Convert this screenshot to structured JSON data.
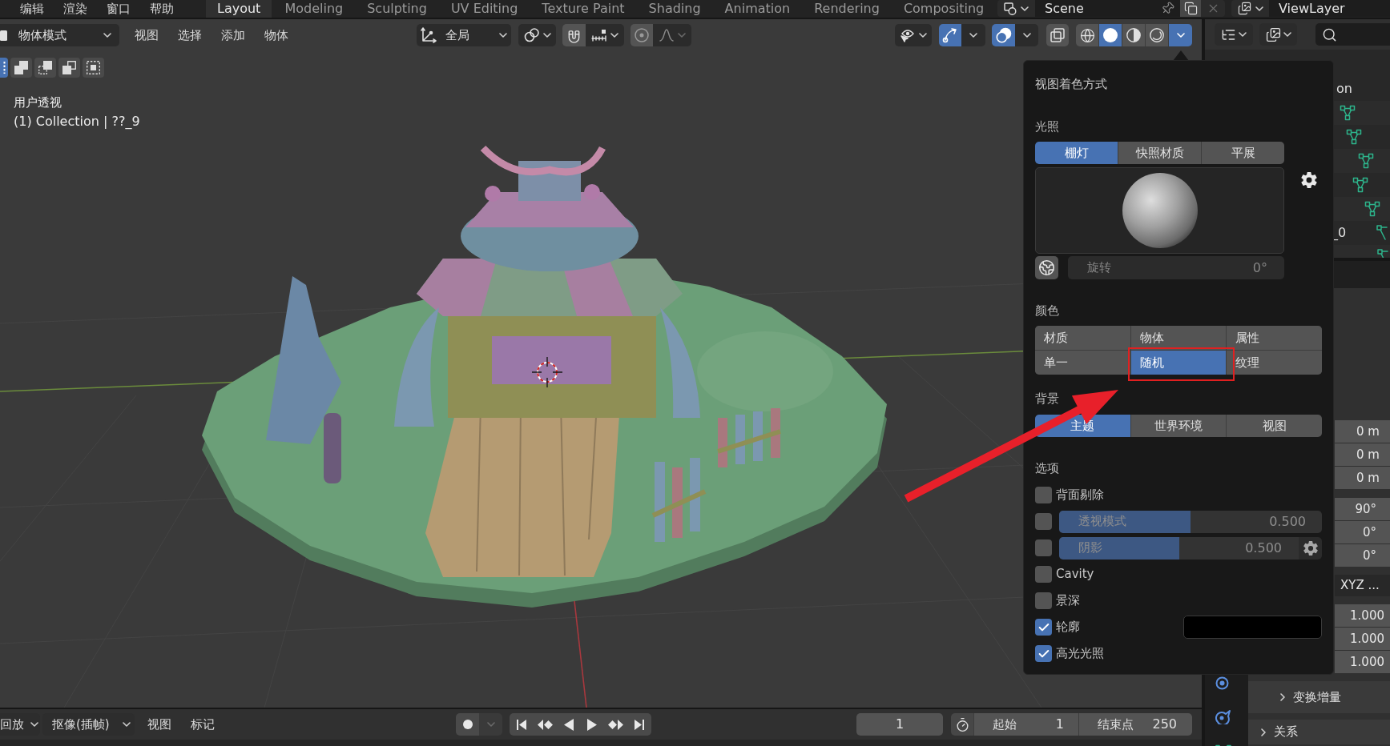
{
  "top_bar": {
    "menus": [
      "编辑",
      "渲染",
      "窗口",
      "帮助"
    ],
    "workspaces": [
      {
        "label": "Layout",
        "selected": true
      },
      {
        "label": "Modeling",
        "selected": false
      },
      {
        "label": "Sculpting",
        "selected": false
      },
      {
        "label": "UV Editing",
        "selected": false
      },
      {
        "label": "Texture Paint",
        "selected": false
      },
      {
        "label": "Shading",
        "selected": false
      },
      {
        "label": "Animation",
        "selected": false
      },
      {
        "label": "Rendering",
        "selected": false
      },
      {
        "label": "Compositing",
        "selected": false
      }
    ],
    "scene": "Scene",
    "view_layer": "ViewLayer"
  },
  "viewport_header": {
    "mode": "物体模式",
    "menus": [
      "视图",
      "选择",
      "添加",
      "物体"
    ],
    "orientation": "全局",
    "gizmos_on": true,
    "overlays_on": true,
    "xray_on": false,
    "shading_modes": [
      {
        "kind": "wireframe",
        "selected": false
      },
      {
        "kind": "solid",
        "selected": true
      },
      {
        "kind": "material",
        "selected": false
      },
      {
        "kind": "rendered",
        "selected": false
      }
    ],
    "shading_menu_open": true
  },
  "tool_header": {
    "select_modes": [
      {
        "kind": "set",
        "selected": true
      },
      {
        "kind": "extend",
        "selected": false
      },
      {
        "kind": "subtract",
        "selected": false
      },
      {
        "kind": "invert",
        "selected": false
      },
      {
        "kind": "intersect",
        "selected": false
      }
    ]
  },
  "viewport": {
    "view_name": "用户透视",
    "collection_info": "(1) Collection | ??_9"
  },
  "shading_popover": {
    "title": "视图着色方式",
    "lighting": {
      "label": "光照",
      "options": [
        {
          "label": "棚灯",
          "selected": true
        },
        {
          "label": "快照材质",
          "selected": false
        },
        {
          "label": "平展",
          "selected": false
        }
      ],
      "rotation": {
        "label": "旋转",
        "value": "0°",
        "disabled": true
      }
    },
    "color": {
      "label": "颜色",
      "options": [
        {
          "label": "材质",
          "selected": false
        },
        {
          "label": "物体",
          "selected": false
        },
        {
          "label": "属性",
          "selected": false
        },
        {
          "label": "单一",
          "selected": false
        },
        {
          "label": "随机",
          "selected": true
        },
        {
          "label": "纹理",
          "selected": false
        }
      ]
    },
    "background": {
      "label": "背景",
      "options": [
        {
          "label": "主题",
          "selected": true
        },
        {
          "label": "世界环境",
          "selected": false
        },
        {
          "label": "视图",
          "selected": false
        }
      ]
    },
    "options": {
      "label": "选项",
      "items": [
        {
          "kind": "checkbox",
          "label": "背面剔除",
          "checked": false
        },
        {
          "kind": "slider",
          "label": "透视模式",
          "checked": false,
          "value": "0.500",
          "level": 0.5,
          "settings": false
        },
        {
          "kind": "slider",
          "label": "阴影",
          "checked": false,
          "value": "0.500",
          "level": 0.5,
          "settings": true
        },
        {
          "kind": "checkbox",
          "label": "Cavity",
          "checked": false
        },
        {
          "kind": "checkbox",
          "label": "景深",
          "checked": false
        },
        {
          "kind": "color",
          "label": "轮廓",
          "checked": true,
          "color": "#000000"
        },
        {
          "kind": "checkbox",
          "label": "高光光照",
          "checked": true
        }
      ]
    }
  },
  "outliner": {
    "row_labels": [
      "on",
      "_0"
    ]
  },
  "properties": {
    "location": [
      "0 m",
      "0 m",
      "0 m"
    ],
    "rotation": [
      "90°",
      "0°",
      "0°"
    ],
    "rotation_mode": "XYZ ...",
    "scale": [
      "1.000",
      "1.000",
      "1.000"
    ],
    "panels": [
      {
        "label": "变换增量",
        "expanded": false
      },
      {
        "label": "关系",
        "expanded": false
      }
    ]
  },
  "timeline": {
    "playback": "回放",
    "keying": "抠像(插帧)",
    "menus": [
      "视图",
      "标记"
    ],
    "current_frame": "1",
    "start": {
      "label": "起始",
      "value": "1"
    },
    "end": {
      "label": "结束点",
      "value": "250"
    }
  }
}
